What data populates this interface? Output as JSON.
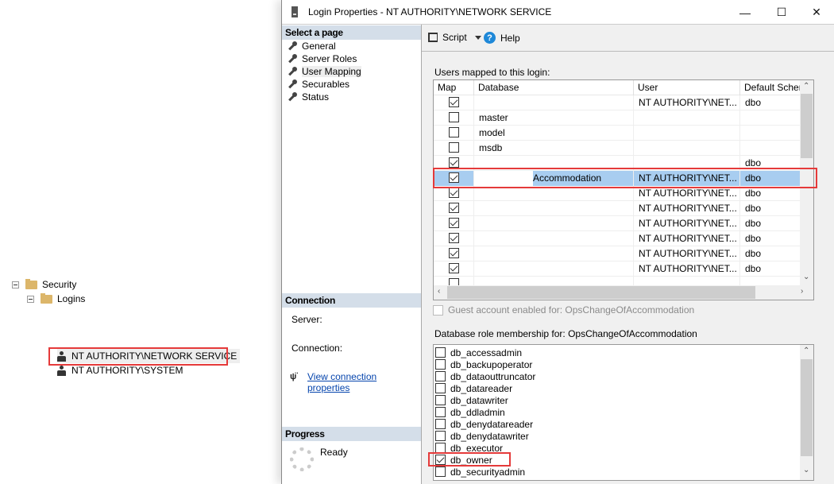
{
  "explorer": {
    "nodes": [
      {
        "label": "Security",
        "type": "folder",
        "expanded": true
      },
      {
        "label": "Logins",
        "type": "folder",
        "expanded": true
      },
      {
        "label": "NT AUTHORITY\\NETWORK SERVICE",
        "type": "login",
        "highlighted": true
      },
      {
        "label": "NT AUTHORITY\\SYSTEM",
        "type": "login"
      }
    ]
  },
  "window": {
    "title": "Login Properties - NT AUTHORITY\\NETWORK SERVICE",
    "controls": {
      "minimize": "—",
      "maximize": "☐",
      "close": "✕"
    }
  },
  "left_pane": {
    "select_page_header": "Select a page",
    "pages": [
      {
        "label": "General"
      },
      {
        "label": "Server Roles"
      },
      {
        "label": "User Mapping",
        "selected": true
      },
      {
        "label": "Securables"
      },
      {
        "label": "Status"
      }
    ],
    "connection_header": "Connection",
    "server_label": "Server:",
    "connection_label": "Connection:",
    "view_connection_link": "View connection properties",
    "progress_header": "Progress",
    "progress_status": "Ready"
  },
  "toolbar": {
    "script_label": "Script",
    "help_label": "Help"
  },
  "users_mapped": {
    "label": "Users mapped to this login:",
    "columns": [
      "Map",
      "Database",
      "User",
      "Default Schema"
    ],
    "rows": [
      {
        "map": true,
        "database": "",
        "user": "NT AUTHORITY\\NET...",
        "schema": "dbo"
      },
      {
        "map": false,
        "database": "master",
        "user": "",
        "schema": ""
      },
      {
        "map": false,
        "database": "model",
        "user": "",
        "schema": ""
      },
      {
        "map": false,
        "database": "msdb",
        "user": "",
        "schema": ""
      },
      {
        "map": true,
        "database": "",
        "user": "",
        "schema": "dbo"
      },
      {
        "map": true,
        "database": "Accommodation",
        "user": "NT AUTHORITY\\NET...",
        "schema": "dbo",
        "selected": true
      },
      {
        "map": true,
        "database": "",
        "user": "NT AUTHORITY\\NET...",
        "schema": "dbo"
      },
      {
        "map": true,
        "database": "",
        "user": "NT AUTHORITY\\NET...",
        "schema": "dbo"
      },
      {
        "map": true,
        "database": "",
        "user": "NT AUTHORITY\\NET...",
        "schema": "dbo"
      },
      {
        "map": true,
        "database": "",
        "user": "NT AUTHORITY\\NET...",
        "schema": "dbo"
      },
      {
        "map": true,
        "database": "",
        "user": "NT AUTHORITY\\NET...",
        "schema": "dbo"
      },
      {
        "map": true,
        "database": "",
        "user": "NT AUTHORITY\\NET...",
        "schema": "dbo"
      },
      {
        "map": false,
        "database": "",
        "user": "",
        "schema": ""
      }
    ]
  },
  "guest_account": {
    "label": "Guest account enabled for: OpsChangeOfAccommodation",
    "checked": false,
    "enabled": false
  },
  "role_membership": {
    "label": "Database role membership for: OpsChangeOfAccommodation",
    "roles": [
      {
        "name": "db_accessadmin",
        "checked": false
      },
      {
        "name": "db_backupoperator",
        "checked": false
      },
      {
        "name": "db_dataouttruncator",
        "checked": false
      },
      {
        "name": "db_datareader",
        "checked": false
      },
      {
        "name": "db_datawriter",
        "checked": false
      },
      {
        "name": "db_ddladmin",
        "checked": false
      },
      {
        "name": "db_denydatareader",
        "checked": false
      },
      {
        "name": "db_denydatawriter",
        "checked": false
      },
      {
        "name": "db_executor",
        "checked": false
      },
      {
        "name": "db_owner",
        "checked": true
      },
      {
        "name": "db_securityadmin",
        "checked": false
      }
    ]
  },
  "colors": {
    "highlight": "#e53a3a",
    "selection": "#a8cdf0",
    "section_header": "#d4dee9",
    "link": "#0645ad"
  }
}
